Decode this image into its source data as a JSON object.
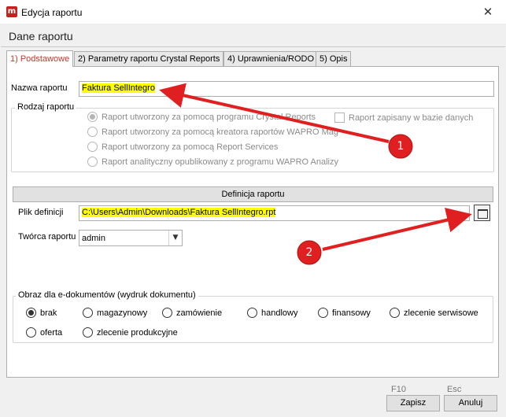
{
  "window": {
    "app_icon_letter": "m",
    "title": "Edycja raportu",
    "close_glyph": "✕"
  },
  "header": {
    "title": "Dane raportu"
  },
  "tabs": [
    {
      "label": "1) Podstawowe",
      "active": true
    },
    {
      "label": "2) Parametry raportu Crystal Reports",
      "active": false
    },
    {
      "label": "4) Uprawnienia/RODO",
      "active": false
    },
    {
      "label": "5) Opis",
      "active": false
    }
  ],
  "report_name": {
    "label": "Nazwa raportu",
    "value": "Faktura SellIntegro"
  },
  "report_type": {
    "title": "Rodzaj raportu",
    "options": [
      {
        "label": "Raport utworzony za pomocą programu Crystal Reports",
        "checked": true
      },
      {
        "label": "Raport utworzony za pomocą kreatora raportów WAPRO Mag",
        "checked": false
      },
      {
        "label": "Raport utworzony za pomocą Report Services",
        "checked": false
      },
      {
        "label": "Raport analityczny opublikowany z programu WAPRO Analizy",
        "checked": false
      }
    ],
    "saved_in_db_label": "Raport zapisany w bazie danych"
  },
  "definition": {
    "section_title": "Definicja raportu",
    "file_label": "Plik definicji",
    "file_value": "C:\\Users\\Admin\\Downloads\\Faktura SellIntegro.rpt",
    "author_label": "Twórca raportu",
    "author_value": "admin",
    "dropdown_glyph": "▼"
  },
  "edoc": {
    "title": "Obraz dla e-dokumentów (wydruk dokumentu)",
    "options": [
      {
        "label": "brak",
        "checked": true
      },
      {
        "label": "magazynowy",
        "checked": false
      },
      {
        "label": "zamówienie",
        "checked": false
      },
      {
        "label": "handlowy",
        "checked": false
      },
      {
        "label": "finansowy",
        "checked": false
      },
      {
        "label": "zlecenie serwisowe",
        "checked": false
      },
      {
        "label": "oferta",
        "checked": false
      },
      {
        "label": "zlecenie produkcyjne",
        "checked": false
      }
    ]
  },
  "footer": {
    "save_key": "F10",
    "save_label": "Zapisz",
    "cancel_key": "Esc",
    "cancel_label": "Anuluj"
  },
  "annotations": [
    {
      "number": "1"
    },
    {
      "number": "2"
    }
  ],
  "colors": {
    "highlight": "#ffff00",
    "annotation_red": "#e02020",
    "active_tab_text": "#c0392b"
  }
}
